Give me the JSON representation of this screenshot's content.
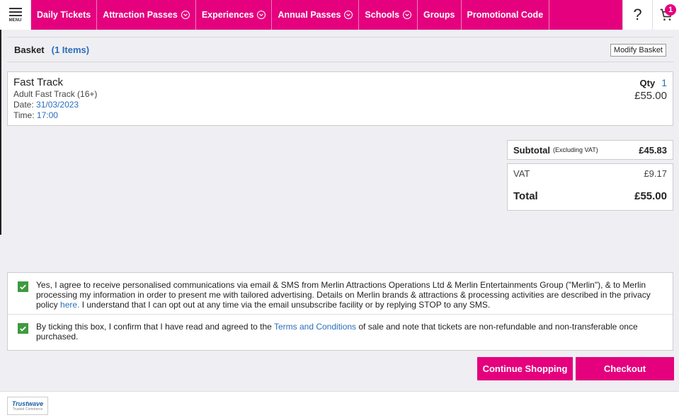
{
  "nav": {
    "menu_label": "MENU",
    "items": [
      {
        "label": "Daily Tickets",
        "dropdown": false
      },
      {
        "label": "Attraction Passes",
        "dropdown": true
      },
      {
        "label": "Experiences",
        "dropdown": true
      },
      {
        "label": "Annual Passes",
        "dropdown": true
      },
      {
        "label": "Schools",
        "dropdown": true
      },
      {
        "label": "Groups",
        "dropdown": false
      },
      {
        "label": "Promotional Code",
        "dropdown": false
      }
    ],
    "help_label": "?",
    "cart_count": "1"
  },
  "basket": {
    "title": "Basket",
    "count": "(1 Items)",
    "modify_label": "Modify Basket"
  },
  "item": {
    "name": "Fast Track",
    "type": "Adult Fast Track (16+)",
    "date_label": "Date:",
    "date": "31/03/2023",
    "time_label": "Time:",
    "time": "17:00",
    "qty_label": "Qty",
    "qty": "1",
    "price": "£55.00"
  },
  "totals": {
    "subtotal_label": "Subtotal",
    "subtotal_note": "(Excluding VAT)",
    "subtotal": "£45.83",
    "vat_label": "VAT",
    "vat": "£9.17",
    "total_label": "Total",
    "total": "£55.00"
  },
  "consent": {
    "marketing_text_1": "Yes, I agree to receive personalised communications via email & SMS from Merlin Attractions Operations Ltd & Merlin Entertainments Group (\"Merlin\"), & to Merlin processing my information in order to present me with tailored advertising. Details on Merlin brands & attractions & processing activities are described in the privacy policy ",
    "marketing_link": "here.",
    "marketing_text_2": " I understand that I can opt out at any time via the email unsubscribe facility or by replying STOP to any SMS.",
    "terms_text_1": "By ticking this box, I confirm that I have read and agreed to the ",
    "terms_link": "Terms and Conditions",
    "terms_text_2": " of sale and note that tickets are non-refundable and non-transferable once purchased."
  },
  "actions": {
    "continue_label": "Continue Shopping",
    "checkout_label": "Checkout"
  },
  "footer": {
    "trustwave_title": "Trustwave",
    "trustwave_sub": "Trusted Commerce"
  },
  "colors": {
    "brand": "#e5007e",
    "link": "#2a6ebb",
    "check": "#3e9a3e"
  }
}
